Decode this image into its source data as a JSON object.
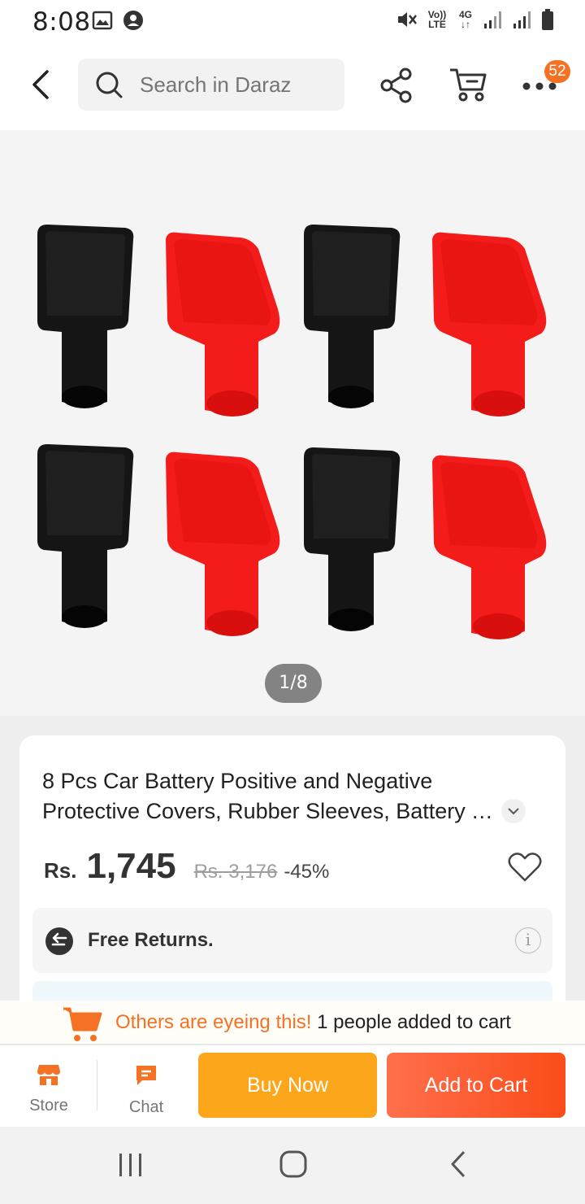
{
  "status_bar": {
    "time": "8:08",
    "icons": [
      "image-icon",
      "account-icon",
      "mute-icon",
      "volte-icon",
      "4g-icon",
      "signal-icon",
      "signal-icon",
      "battery-icon"
    ],
    "volte": "Vo)) LTE",
    "network": "4G"
  },
  "header": {
    "search_placeholder": "Search in Daraz",
    "cart_badge": "52"
  },
  "gallery": {
    "counter": "1/8",
    "colors": {
      "black_cap": "#141414",
      "red_cap": "#f41c1a",
      "background": "#f4f4f4"
    }
  },
  "product": {
    "title_line1": "8 Pcs Car Battery Positive and Negative",
    "title_line2": "Protective Covers, Rubber Sleeves, Battery Terminal Covers",
    "currency": "Rs.",
    "price": "1,745",
    "original_price": "Rs. 3,176",
    "discount": "-45%",
    "returns_label": "Free Returns.",
    "info_icon_text": "i"
  },
  "eyeing_banner": {
    "highlight": "Others are eyeing this!",
    "text": "1 people added to cart"
  },
  "action_bar": {
    "store_label": "Store",
    "chat_label": "Chat",
    "buy_now_label": "Buy Now",
    "add_to_cart_label": "Add to Cart",
    "accent_color": "#f57224",
    "buy_color": "#fca61c",
    "cart_color": "#fb4c1a"
  }
}
